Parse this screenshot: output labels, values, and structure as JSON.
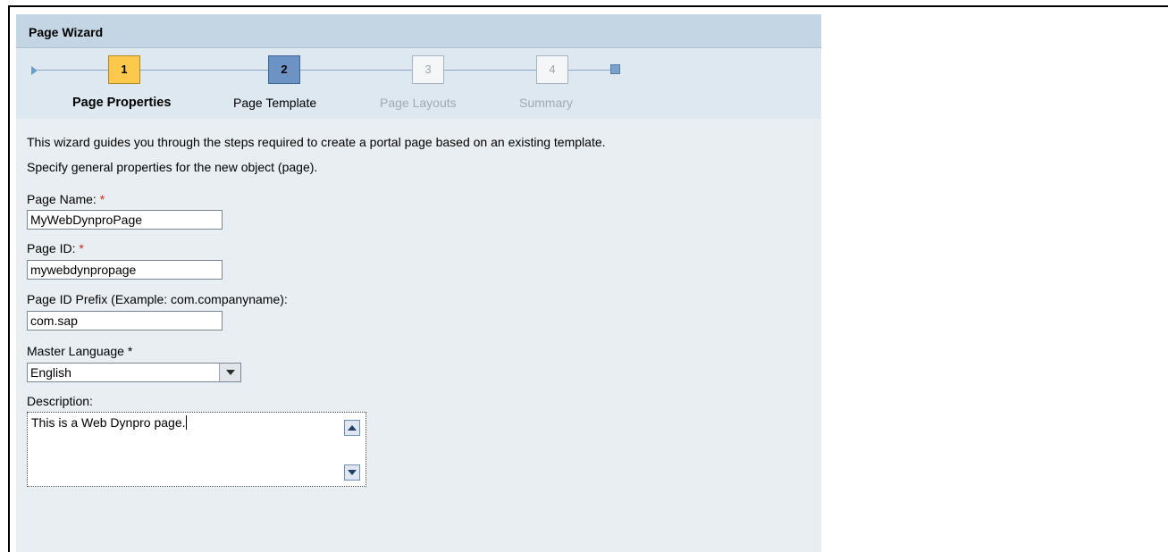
{
  "panel": {
    "title": "Page Wizard"
  },
  "roadmap": {
    "steps": [
      {
        "number": "1",
        "label": "Page Properties",
        "state": "current"
      },
      {
        "number": "2",
        "label": "Page Template",
        "state": "next"
      },
      {
        "number": "3",
        "label": "Page Layouts",
        "state": "disabled"
      },
      {
        "number": "4",
        "label": "Summary",
        "state": "disabled"
      }
    ]
  },
  "intro": {
    "line1": "This wizard guides you through the steps required to create a portal page based on an existing template.",
    "line2": "Specify general properties for the new object (page)."
  },
  "form": {
    "page_name": {
      "label": "Page Name: ",
      "required_mark": "*",
      "value": "MyWebDynproPage"
    },
    "page_id": {
      "label": "Page ID: ",
      "required_mark": "*",
      "value": "mywebdynpropage"
    },
    "page_id_prefix": {
      "label": "Page ID Prefix (Example: com.companyname):",
      "value": "com.sap"
    },
    "master_language": {
      "label": "Master Language *",
      "value": "English"
    },
    "description": {
      "label": "Description:",
      "value": "This is a Web Dynpro page."
    }
  },
  "colors": {
    "header_bg": "#c4d5e3",
    "panel_bg": "#e9eef2",
    "current_step": "#fcc94c",
    "next_step": "#6d93c4",
    "required": "#d4281c"
  }
}
